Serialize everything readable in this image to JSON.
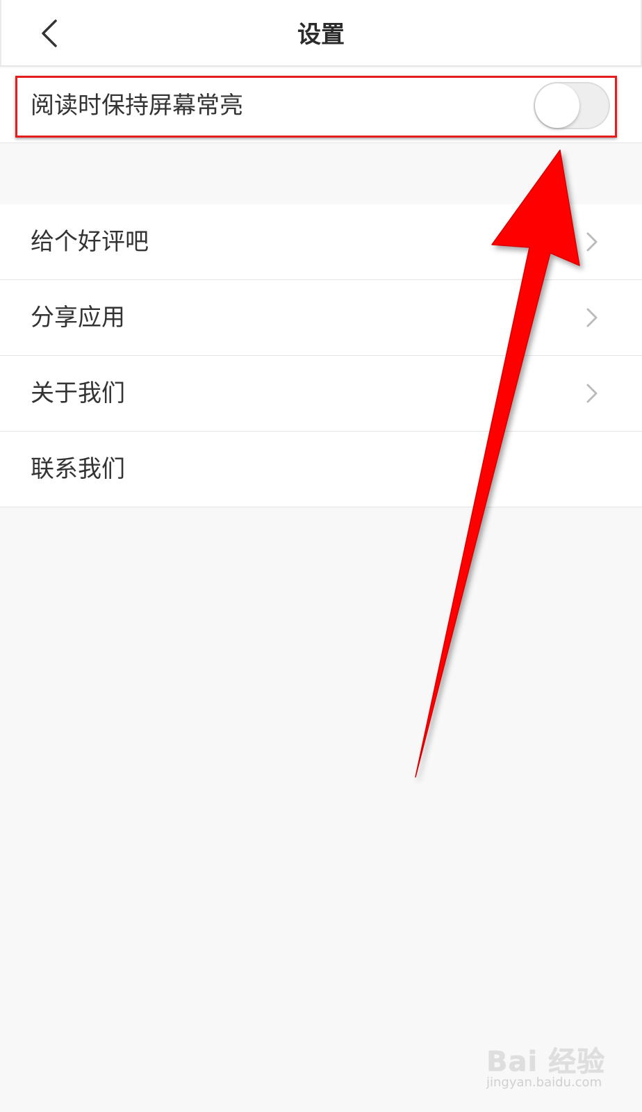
{
  "header": {
    "title": "设置",
    "back_icon": "chevron-left-icon"
  },
  "settings": {
    "keep_screen_on": {
      "label": "阅读时保持屏幕常亮",
      "enabled": false
    }
  },
  "menu": {
    "items": [
      {
        "label": "给个好评吧",
        "has_chevron": true
      },
      {
        "label": "分享应用",
        "has_chevron": true
      },
      {
        "label": "关于我们",
        "has_chevron": true
      },
      {
        "label": "联系我们",
        "has_chevron": false
      }
    ]
  },
  "annotation": {
    "highlight_color": "#e41e1e",
    "arrow_color": "#ff0000"
  },
  "watermark": {
    "brand": "Bai 经验",
    "url": "jingyan.baidu.com"
  },
  "colors": {
    "background": "#f8f8f8",
    "surface": "#ffffff",
    "text": "#333333",
    "divider": "#e4e4e4"
  }
}
